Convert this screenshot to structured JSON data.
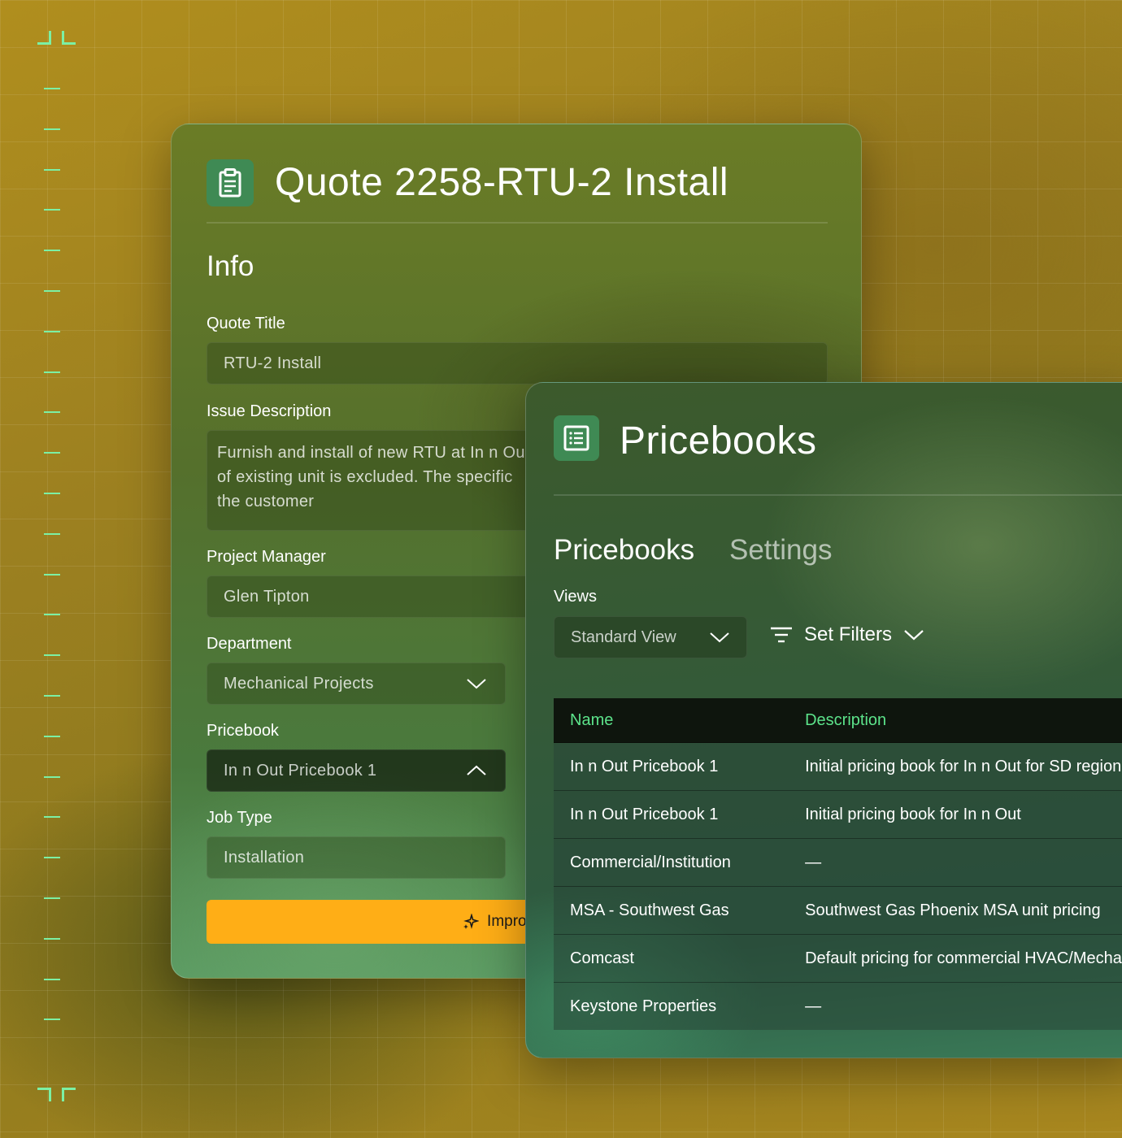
{
  "quote": {
    "title": "Quote 2258-RTU-2 Install",
    "section": "Info",
    "fields": {
      "quote_title_label": "Quote Title",
      "quote_title_value": "RTU-2 Install",
      "issue_label": "Issue Description",
      "issue_lines": [
        "Furnish and install of new RTU at In n Out",
        "of existing unit is excluded. The specific",
        "the customer"
      ],
      "pm_label": "Project Manager",
      "pm_value": "Glen Tipton",
      "dept_label": "Department",
      "dept_value": "Mechanical Projects",
      "pricebook_label": "Pricebook",
      "pricebook_value": "In n Out Pricebook 1",
      "jobtype_label": "Job Type",
      "jobtype_value": "Installation"
    },
    "improve_label": "Improve with AI"
  },
  "pricebooks": {
    "title": "Pricebooks",
    "tabs": [
      "Pricebooks",
      "Settings"
    ],
    "views_label": "Views",
    "view_value": "Standard View",
    "filters_label": "Set Filters",
    "columns": [
      "Name",
      "Description"
    ],
    "rows": [
      {
        "name": "In n Out Pricebook 1",
        "desc": "Initial pricing book for In n Out for SD region"
      },
      {
        "name": "In n Out Pricebook 1",
        "desc": "Initial pricing book for In n Out"
      },
      {
        "name": "Commercial/Institution",
        "desc": "—"
      },
      {
        "name": "MSA - Southwest Gas",
        "desc": "Southwest Gas Phoenix MSA unit pricing"
      },
      {
        "name": "Comcast",
        "desc": "Default pricing for commercial HVAC/Mechanical"
      },
      {
        "name": "Keystone Properties",
        "desc": "—"
      }
    ]
  },
  "colors": {
    "accent_green": "#5CE38A",
    "button_yellow": "#FFAE16",
    "ruler_green": "#7CF0A4"
  },
  "icons": [
    "clipboard-icon",
    "list-document-icon",
    "chevron-down-icon",
    "chevron-up-icon",
    "filter-icon",
    "sparkle-icon"
  ]
}
